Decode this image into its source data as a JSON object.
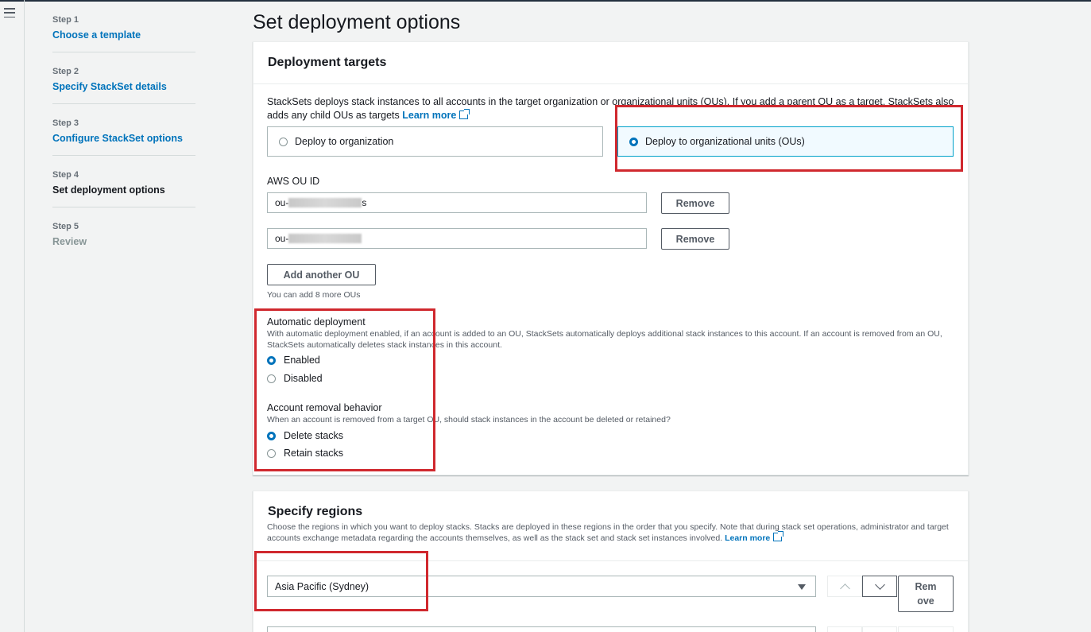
{
  "steps": [
    {
      "number": "Step 1",
      "label": "Choose a template"
    },
    {
      "number": "Step 2",
      "label": "Specify StackSet details"
    },
    {
      "number": "Step 3",
      "label": "Configure StackSet options"
    },
    {
      "number": "Step 4",
      "label": "Set deployment options"
    },
    {
      "number": "Step 5",
      "label": "Review"
    }
  ],
  "page_title": "Set deployment options",
  "deployment_targets": {
    "title": "Deployment targets",
    "description": "StackSets deploys stack instances to all accounts in the target organization or organizational units (OUs). If you add a parent OU as a target, StackSets also adds any child OUs as targets",
    "learn_more": "Learn more",
    "options": [
      {
        "label": "Deploy to organization",
        "selected": false
      },
      {
        "label": "Deploy to organizational units (OUs)",
        "selected": true
      }
    ],
    "ou_label": "AWS OU ID",
    "ou_ids": [
      {
        "prefix": "ou-",
        "suffix": "s"
      },
      {
        "prefix": "ou-",
        "suffix": ""
      }
    ],
    "remove_label": "Remove",
    "add_ou_label": "Add another OU",
    "add_ou_hint": "You can add 8 more OUs",
    "automatic": {
      "title": "Automatic deployment",
      "description": "With automatic deployment enabled, if an account is added to an OU, StackSets automatically deploys additional stack instances to this account. If an account is removed from an OU, StackSets automatically deletes stack instances in this account.",
      "options": [
        {
          "label": "Enabled",
          "selected": true
        },
        {
          "label": "Disabled",
          "selected": false
        }
      ]
    },
    "removal": {
      "title": "Account removal behavior",
      "description": "When an account is removed from a target OU, should stack instances in the account be deleted or retained?",
      "options": [
        {
          "label": "Delete stacks",
          "selected": true
        },
        {
          "label": "Retain stacks",
          "selected": false
        }
      ]
    }
  },
  "regions": {
    "title": "Specify regions",
    "description": "Choose the regions in which you want to deploy stacks. Stacks are deployed in these regions in the order that you specify. Note that during stack set operations, administrator and target accounts exchange metadata regarding the accounts themselves, as well as the stack set and stack set instances involved.",
    "learn_more": "Learn more",
    "selected_region": "Asia Pacific (Sydney)",
    "remove_label_line1": "Rem",
    "remove_label_line2": "ove"
  },
  "colors": {
    "link": "#0073bb",
    "highlight_box": "#d0282e",
    "selected_tile_bg": "#f1faff",
    "selected_tile_border": "#00a1c9"
  }
}
